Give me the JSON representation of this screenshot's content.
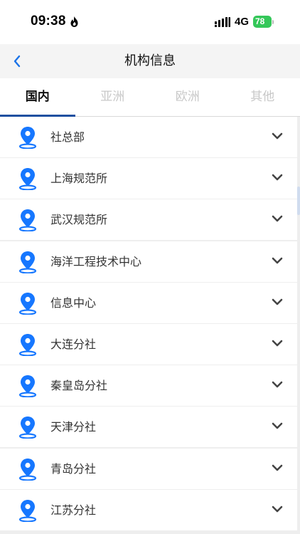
{
  "status_bar": {
    "time": "09:38",
    "network": "4G",
    "battery": "78"
  },
  "nav": {
    "title": "机构信息",
    "back_icon": "chevron-left-icon"
  },
  "tabs": [
    {
      "label": "国内",
      "active": true
    },
    {
      "label": "亚洲",
      "active": false
    },
    {
      "label": "欧洲",
      "active": false
    },
    {
      "label": "其他",
      "active": false
    }
  ],
  "list": {
    "items": [
      {
        "label": "社总部"
      },
      {
        "label": "上海规范所"
      },
      {
        "label": "武汉规范所"
      },
      {
        "label": "海洋工程技术中心"
      },
      {
        "label": "信息中心"
      },
      {
        "label": "大连分社"
      },
      {
        "label": "秦皇岛分社"
      },
      {
        "label": "天津分社"
      },
      {
        "label": "青岛分社"
      },
      {
        "label": "江苏分社"
      }
    ]
  },
  "colors": {
    "accent": "#1e4fa0",
    "pin": "#1677ff",
    "back": "#1a73e8",
    "battery": "#34c759"
  }
}
